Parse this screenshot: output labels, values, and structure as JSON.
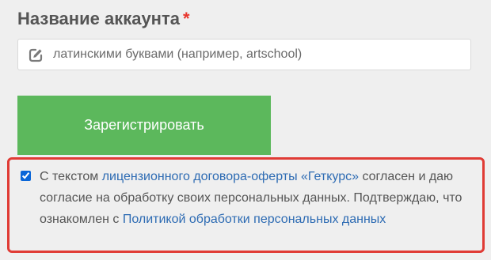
{
  "form": {
    "account_label": "Название аккаунта",
    "required_mark": "*",
    "account_placeholder": "латинскими буквами (например, artschool)",
    "account_value": "",
    "edit_icon": "pencil-square-icon",
    "register_label": "Зарегистрировать"
  },
  "consent": {
    "checked": true,
    "text_1": "С текстом ",
    "license_link": "лицензионного договора-оферты «Геткурс»",
    "text_2": " согласен и даю согласие на обработку своих персональных данных. Подтверждаю, что ознакомлен с ",
    "policy_link": "Политикой обработки персональных данных"
  },
  "colors": {
    "button_green": "#5cb85c",
    "link_blue": "#2d6bb3",
    "highlight_red": "#e03b35",
    "required_red": "#e8352c"
  }
}
